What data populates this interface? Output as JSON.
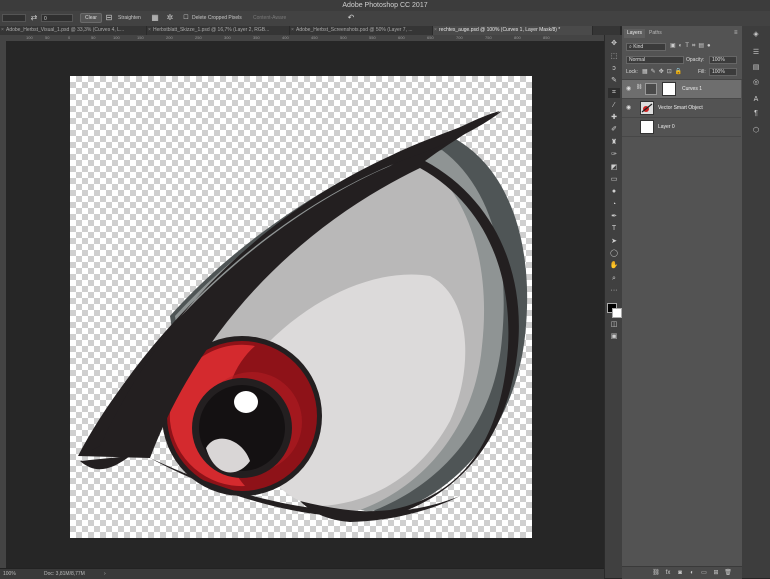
{
  "window": {
    "title": "Adobe Photoshop CC 2017"
  },
  "options": {
    "ratio_value": "0",
    "clear_label": "Clear",
    "straighten_label": "Straighten",
    "delete_cropped_label": "Delete Cropped Pixels",
    "content_aware_label": "Content-Aware"
  },
  "tabs": [
    {
      "label": "Adobe_Herbst_Visual_1.psd @ 33,3% (Curves 4, L..."
    },
    {
      "label": "Herbstblatt_Skizze_1.psd @ 16,7% (Layer 2, RGB..."
    },
    {
      "label": "Adobe_Herbst_Screenshots.psd @ 50% (Layer 7, ..."
    },
    {
      "label": "rechtes_auge.psd @ 100% (Curves 1, Layer Mask/8) *"
    }
  ],
  "ruler": {
    "ticks": [
      "100",
      "50",
      "0",
      "50",
      "100",
      "150",
      "200",
      "250",
      "300",
      "350",
      "400",
      "450",
      "500",
      "550",
      "600",
      "650",
      "700",
      "750",
      "800",
      "850"
    ]
  },
  "status": {
    "zoom": "100%",
    "doc": "Doc: 3,81M/8,77M"
  },
  "layers_panel": {
    "tab_layers": "Layers",
    "tab_paths": "Paths",
    "filter_kind": "Kind",
    "blend_mode": "Normal",
    "opacity_label": "Opacity:",
    "opacity_value": "100%",
    "lock_label": "Lock:",
    "fill_label": "Fill:",
    "fill_value": "100%",
    "layers": [
      {
        "name": "Curves 1",
        "visible": true,
        "selected": true
      },
      {
        "name": "Vector Smart Object",
        "visible": true,
        "selected": false
      },
      {
        "name": "Layer 0",
        "visible": false,
        "selected": false
      }
    ]
  },
  "colors": {
    "iris": "#d42a2e",
    "iris_dark": "#8e1218",
    "outline": "#231f20",
    "sclera": "#dcdada"
  }
}
